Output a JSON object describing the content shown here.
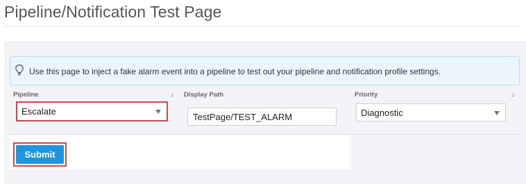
{
  "page": {
    "title": "Pipeline/Notification Test Page"
  },
  "info": {
    "icon": "lightbulb-icon",
    "text": "Use this page to inject a fake alarm event into a pipeline to test out your pipeline and notification profile settings."
  },
  "form": {
    "pipeline": {
      "label": "Pipeline",
      "value": "Escalate",
      "arrow": "↓"
    },
    "display_path": {
      "label": "Display Path",
      "value": "TestPage/TEST_ALARM"
    },
    "priority": {
      "label": "Priority",
      "value": "Diagnostic",
      "arrow": "↓"
    },
    "submit_label": "Submit"
  },
  "colors": {
    "accent": "#1f94e0",
    "highlight": "#d04545",
    "info_bg": "#eaf5fc"
  }
}
